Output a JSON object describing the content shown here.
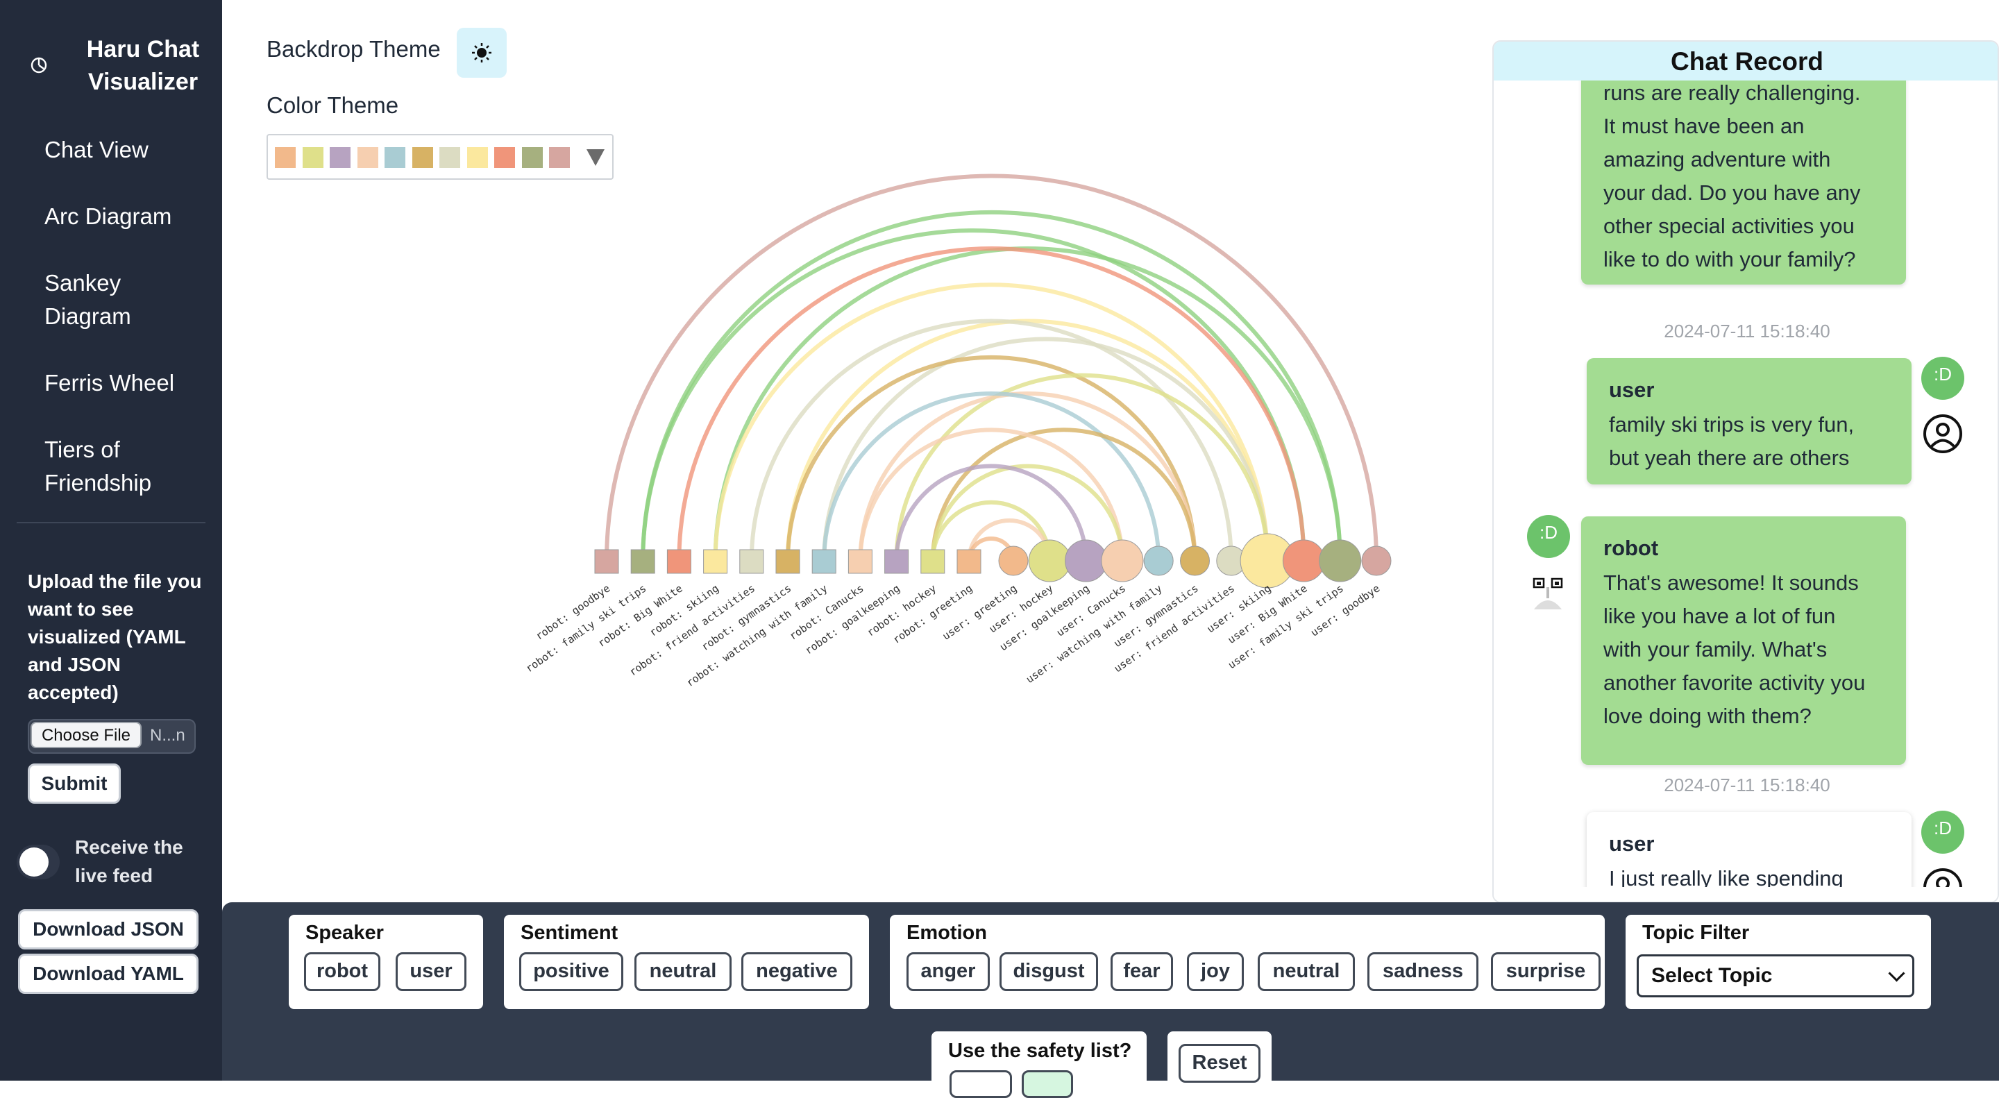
{
  "sidebar": {
    "brand_line1": "Haru Chat",
    "brand_line2": "Visualizer",
    "nav": [
      {
        "line1": "Chat View",
        "line2": ""
      },
      {
        "line1": "Arc Diagram",
        "line2": ""
      },
      {
        "line1": "Sankey",
        "line2": "Diagram"
      },
      {
        "line1": "Ferris Wheel",
        "line2": ""
      },
      {
        "line1": "Tiers of",
        "line2": "Friendship"
      }
    ],
    "upload_text": "Upload the file you want to see visualized (YAML and JSON accepted)",
    "choose_file_label": "Choose File",
    "file_name": "N...n",
    "submit_label": "Submit",
    "live_feed_label": "Receive the live feed",
    "live_feed_on": false,
    "download_json_label": "Download JSON",
    "download_yaml_label": "Download YAML"
  },
  "controls": {
    "backdrop_theme_label": "Backdrop Theme",
    "backdrop_icon": "sun-icon",
    "color_theme_label": "Color Theme",
    "palette": [
      "#f2b98b",
      "#dfe08a",
      "#b7a3c1",
      "#f6cfb0",
      "#a9ccd3",
      "#d7b264",
      "#dcdcc2",
      "#fbe89e",
      "#f0957a",
      "#a6b07f",
      "#d6a6a0"
    ]
  },
  "arc": {
    "robot_nodes": [
      {
        "label": "robot: goodbye",
        "color": "#d6a6a0"
      },
      {
        "label": "robot: family ski trips",
        "color": "#a6b07f"
      },
      {
        "label": "robot: Big White",
        "color": "#f0957a"
      },
      {
        "label": "robot: skiing",
        "color": "#fbe89e"
      },
      {
        "label": "robot: friend activities",
        "color": "#dcdcc2"
      },
      {
        "label": "robot: gymnastics",
        "color": "#d7b264"
      },
      {
        "label": "robot: watching with family",
        "color": "#a9ccd3"
      },
      {
        "label": "robot: Canucks",
        "color": "#f6cfb0"
      },
      {
        "label": "robot: goalkeeping",
        "color": "#b7a3c1"
      },
      {
        "label": "robot: hockey",
        "color": "#dfe08a"
      },
      {
        "label": "robot: greeting",
        "color": "#f2b98b"
      }
    ],
    "user_nodes": [
      {
        "label": "user: greeting",
        "color": "#f2b98b",
        "weight": 1
      },
      {
        "label": "user: hockey",
        "color": "#dfe08a",
        "weight": 2
      },
      {
        "label": "user: goalkeeping",
        "color": "#b7a3c1",
        "weight": 2
      },
      {
        "label": "user: Canucks",
        "color": "#f6cfb0",
        "weight": 2
      },
      {
        "label": "user: watching with family",
        "color": "#a9ccd3",
        "weight": 1
      },
      {
        "label": "user: gymnastics",
        "color": "#d7b264",
        "weight": 1
      },
      {
        "label": "user: friend activities",
        "color": "#dcdcc2",
        "weight": 1
      },
      {
        "label": "user: skiing",
        "color": "#fbe89e",
        "weight": 3
      },
      {
        "label": "user: Big White",
        "color": "#f0957a",
        "weight": 2
      },
      {
        "label": "user: family ski trips",
        "color": "#a6b07f",
        "weight": 2
      },
      {
        "label": "user: goodbye",
        "color": "#d6a6a0",
        "weight": 1
      }
    ],
    "links": [
      {
        "from": "robot: goodbye",
        "to": "user: goodbye",
        "color": "#d6a6a0"
      },
      {
        "from": "robot: family ski trips",
        "to": "user: family ski trips",
        "color": "#8fd17f"
      },
      {
        "from": "robot: family ski trips",
        "to": "user: Big White",
        "color": "#8fd17f"
      },
      {
        "from": "robot: Big White",
        "to": "user: Big White",
        "color": "#f0957a"
      },
      {
        "from": "robot: skiing",
        "to": "user: skiing",
        "color": "#fbe89e"
      },
      {
        "from": "robot: skiing",
        "to": "user: family ski trips",
        "color": "#8fd17f"
      },
      {
        "from": "robot: friend activities",
        "to": "user: friend activities",
        "color": "#dcdcc2"
      },
      {
        "from": "robot: gymnastics",
        "to": "user: gymnastics",
        "color": "#d7b264"
      },
      {
        "from": "robot: gymnastics",
        "to": "user: skiing",
        "color": "#fbe89e"
      },
      {
        "from": "robot: watching with family",
        "to": "user: watching with family",
        "color": "#a9ccd3"
      },
      {
        "from": "robot: watching with family",
        "to": "user: skiing",
        "color": "#dcdcc2"
      },
      {
        "from": "robot: Canucks",
        "to": "user: Canucks",
        "color": "#f6cfb0"
      },
      {
        "from": "robot: Canucks",
        "to": "user: gymnastics",
        "color": "#f6cfb0"
      },
      {
        "from": "robot: goalkeeping",
        "to": "user: goalkeeping",
        "color": "#b7a3c1"
      },
      {
        "from": "robot: goalkeeping",
        "to": "user: skiing",
        "color": "#dfe08a"
      },
      {
        "from": "robot: hockey",
        "to": "user: hockey",
        "color": "#dfe08a"
      },
      {
        "from": "robot: hockey",
        "to": "user: Canucks",
        "color": "#dfe08a"
      },
      {
        "from": "robot: hockey",
        "to": "user: gymnastics",
        "color": "#d7b264"
      },
      {
        "from": "robot: greeting",
        "to": "user: greeting",
        "color": "#f2b98b"
      },
      {
        "from": "robot: greeting",
        "to": "user: hockey",
        "color": "#f6cfb0"
      }
    ]
  },
  "chat": {
    "header": "Chat Record",
    "messages": [
      {
        "speaker": "",
        "style": "green",
        "lines": [
          "runs are really challenging.",
          "It must have been an",
          "amazing adventure with",
          "your dad. Do you have any",
          "other special activities you",
          "like to do with your family?"
        ]
      },
      {
        "timestamp": "2024-07-11 15:18:40",
        "speaker": "user",
        "mood": ":D",
        "style": "green",
        "lines": [
          "family ski trips is very fun,",
          "but yeah there are others"
        ]
      },
      {
        "speaker": "robot",
        "mood": ":D",
        "style": "green",
        "lines": [
          "That's awesome! It sounds",
          "like you have a lot of fun",
          "with your family. What's",
          "another favorite activity you",
          "love doing with them?"
        ]
      },
      {
        "timestamp": "2024-07-11 15:18:40",
        "speaker": "user",
        "mood": ":D",
        "style": "white",
        "lines": [
          "I just really like spending"
        ]
      }
    ]
  },
  "filters": {
    "speaker": {
      "title": "Speaker",
      "options": [
        "robot",
        "user"
      ]
    },
    "sentiment": {
      "title": "Sentiment",
      "options": [
        "positive",
        "neutral",
        "negative"
      ]
    },
    "emotion": {
      "title": "Emotion",
      "options": [
        "anger",
        "disgust",
        "fear",
        "joy",
        "neutral",
        "sadness",
        "surprise"
      ]
    },
    "topic": {
      "title": "Topic Filter",
      "selected": "Select Topic"
    },
    "safety": {
      "title": "Use the safety list?"
    },
    "reset_label": "Reset"
  }
}
